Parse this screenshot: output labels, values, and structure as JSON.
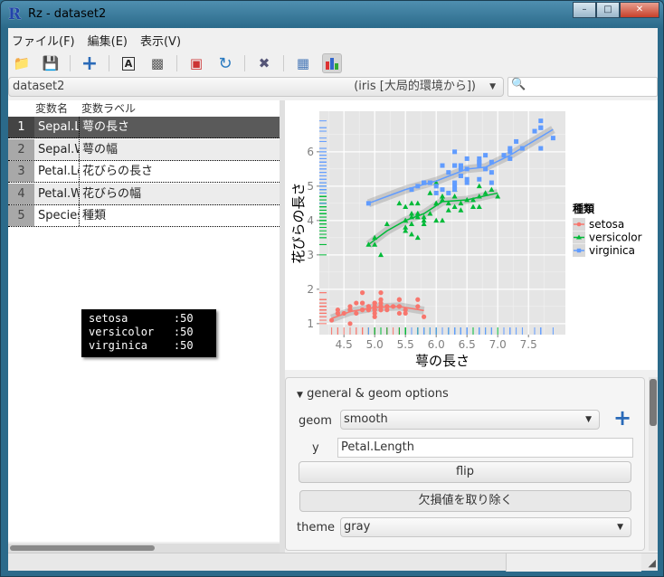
{
  "window": {
    "title": "Rz - dataset2",
    "logo": "R"
  },
  "menu": [
    "ファイル(F)",
    "編集(E)",
    "表示(V)"
  ],
  "toolbar": [
    {
      "icon": "open-folder-icon"
    },
    {
      "icon": "save-icon"
    },
    {
      "icon": "add-icon"
    },
    {
      "icon": "label-icon"
    },
    {
      "icon": "delete-icon"
    },
    {
      "icon": "import-icon"
    },
    {
      "icon": "refresh-icon"
    },
    {
      "icon": "tools-icon"
    },
    {
      "icon": "data-view-icon"
    },
    {
      "icon": "plot-view-icon",
      "active": true
    }
  ],
  "dataset": {
    "name": "dataset2",
    "source": "(iris [大局的環境から])"
  },
  "search": {
    "placeholder": ""
  },
  "variables": {
    "headers": [
      "変数名",
      "変数ラベル"
    ],
    "rows": [
      {
        "num": "1",
        "name": "Sepal.Length",
        "label": "萼の長さ"
      },
      {
        "num": "2",
        "name": "Sepal.Width",
        "label": "萼の幅"
      },
      {
        "num": "3",
        "name": "Petal.Length",
        "label": "花びらの長さ"
      },
      {
        "num": "4",
        "name": "Petal.Width",
        "label": "花びらの幅"
      },
      {
        "num": "5",
        "name": "Species",
        "label": "種類"
      }
    ],
    "selected": 0
  },
  "tooltip": "setosa       :50\nversicolor   :50\nvirginica    :50",
  "options": {
    "section": "general & geom options",
    "geom_label": "geom",
    "geom_value": "smooth",
    "y_label": "y",
    "y_value": "Petal.Length",
    "flip_label": "flip",
    "remove_na_label": "欠損値を取り除く",
    "theme_label": "theme",
    "theme_value": "gray"
  },
  "chart_data": {
    "type": "scatter",
    "xlabel": "萼の長さ",
    "ylabel": "花びらの長さ",
    "xlim": [
      4.1,
      8.1
    ],
    "ylim": [
      0.68,
      7.18
    ],
    "xticks": [
      "4.5",
      "5.0",
      "5.5",
      "6.0",
      "6.5",
      "7.0",
      "7.5"
    ],
    "yticks": [
      "1",
      "2",
      "3",
      "4",
      "5",
      "6"
    ],
    "grid": true,
    "rug": true,
    "smooth": true,
    "legend": {
      "title": "種類",
      "position": "right"
    },
    "series": [
      {
        "name": "setosa",
        "color": "#F8766D",
        "shape": "circle",
        "x": [
          5.1,
          4.9,
          4.7,
          4.6,
          5.0,
          5.4,
          4.6,
          5.0,
          4.4,
          4.9,
          5.4,
          4.8,
          4.8,
          4.3,
          5.8,
          5.7,
          5.4,
          5.1,
          5.7,
          5.1,
          5.4,
          5.1,
          4.6,
          5.1,
          4.8,
          5.0,
          5.0,
          5.2,
          5.2,
          4.7,
          4.8,
          5.4,
          5.2,
          5.5,
          4.9,
          5.0,
          5.5,
          4.9,
          4.4,
          5.1,
          5.0,
          4.5,
          4.4,
          5.0,
          5.1,
          4.8,
          5.1,
          4.6,
          5.3,
          5.0
        ],
        "y": [
          1.4,
          1.4,
          1.3,
          1.5,
          1.4,
          1.7,
          1.4,
          1.5,
          1.4,
          1.5,
          1.5,
          1.6,
          1.4,
          1.1,
          1.2,
          1.5,
          1.3,
          1.4,
          1.7,
          1.5,
          1.7,
          1.5,
          1.0,
          1.7,
          1.9,
          1.6,
          1.6,
          1.5,
          1.4,
          1.6,
          1.6,
          1.5,
          1.5,
          1.4,
          1.5,
          1.2,
          1.3,
          1.4,
          1.3,
          1.5,
          1.3,
          1.3,
          1.3,
          1.6,
          1.9,
          1.4,
          1.6,
          1.4,
          1.5,
          1.4
        ],
        "smooth": [
          [
            4.3,
            1.15
          ],
          [
            4.6,
            1.35
          ],
          [
            5.0,
            1.47
          ],
          [
            5.4,
            1.5
          ],
          [
            5.8,
            1.38
          ]
        ]
      },
      {
        "name": "versicolor",
        "color": "#00BA38",
        "shape": "triangle",
        "x": [
          7.0,
          6.4,
          6.9,
          5.5,
          6.5,
          5.7,
          6.3,
          4.9,
          6.6,
          5.2,
          5.0,
          5.9,
          6.0,
          6.1,
          5.6,
          6.7,
          5.6,
          5.8,
          6.2,
          5.6,
          5.9,
          6.1,
          6.3,
          6.1,
          6.4,
          6.6,
          6.8,
          6.7,
          6.0,
          5.7,
          5.5,
          5.5,
          5.8,
          6.0,
          5.4,
          6.0,
          6.7,
          6.3,
          5.6,
          5.5,
          5.5,
          6.1,
          5.8,
          5.0,
          5.6,
          5.7,
          5.7,
          6.2,
          5.1,
          5.7
        ],
        "y": [
          4.7,
          4.5,
          4.9,
          4.0,
          4.6,
          4.5,
          4.7,
          3.3,
          4.6,
          3.9,
          3.5,
          4.2,
          4.0,
          4.7,
          3.6,
          4.4,
          4.5,
          4.1,
          4.5,
          3.9,
          4.8,
          4.0,
          4.9,
          4.7,
          4.3,
          4.4,
          4.8,
          5.0,
          4.5,
          3.5,
          3.8,
          3.7,
          3.9,
          5.1,
          4.5,
          4.5,
          4.7,
          4.4,
          4.1,
          4.0,
          4.4,
          4.6,
          4.0,
          3.3,
          4.2,
          4.2,
          4.2,
          4.3,
          3.0,
          4.1
        ],
        "smooth": [
          [
            4.9,
            3.3
          ],
          [
            5.2,
            3.7
          ],
          [
            5.5,
            4.0
          ],
          [
            5.8,
            4.2
          ],
          [
            6.1,
            4.55
          ],
          [
            6.5,
            4.6
          ],
          [
            7.0,
            4.8
          ]
        ]
      },
      {
        "name": "virginica",
        "color": "#619CFF",
        "shape": "square",
        "x": [
          6.3,
          5.8,
          7.1,
          6.3,
          6.5,
          7.6,
          4.9,
          7.3,
          6.7,
          7.2,
          6.5,
          6.4,
          6.8,
          5.7,
          5.8,
          6.4,
          6.5,
          7.7,
          7.7,
          6.0,
          6.9,
          5.6,
          7.7,
          6.3,
          6.7,
          7.2,
          6.2,
          6.1,
          6.4,
          7.2,
          7.4,
          7.9,
          6.4,
          6.3,
          6.1,
          7.7,
          6.3,
          6.4,
          6.0,
          6.9,
          6.7,
          6.9,
          5.8,
          6.8,
          6.7,
          6.7,
          6.3,
          6.5,
          6.2,
          5.9
        ],
        "y": [
          6.0,
          5.1,
          5.9,
          5.6,
          5.8,
          6.6,
          4.5,
          6.3,
          5.8,
          6.1,
          5.1,
          5.3,
          5.5,
          5.0,
          5.1,
          5.3,
          5.5,
          6.7,
          6.9,
          5.0,
          5.7,
          4.9,
          6.7,
          4.9,
          5.7,
          6.0,
          4.8,
          4.9,
          5.6,
          5.8,
          6.1,
          6.4,
          5.6,
          5.1,
          5.6,
          6.1,
          5.6,
          5.5,
          4.8,
          5.4,
          5.6,
          5.1,
          5.1,
          5.9,
          5.7,
          5.2,
          5.0,
          5.2,
          5.4,
          5.1
        ],
        "smooth": [
          [
            4.9,
            4.5
          ],
          [
            5.5,
            4.9
          ],
          [
            6.0,
            5.15
          ],
          [
            6.5,
            5.5
          ],
          [
            6.8,
            5.55
          ],
          [
            7.2,
            5.9
          ],
          [
            7.9,
            6.65
          ]
        ]
      }
    ]
  }
}
